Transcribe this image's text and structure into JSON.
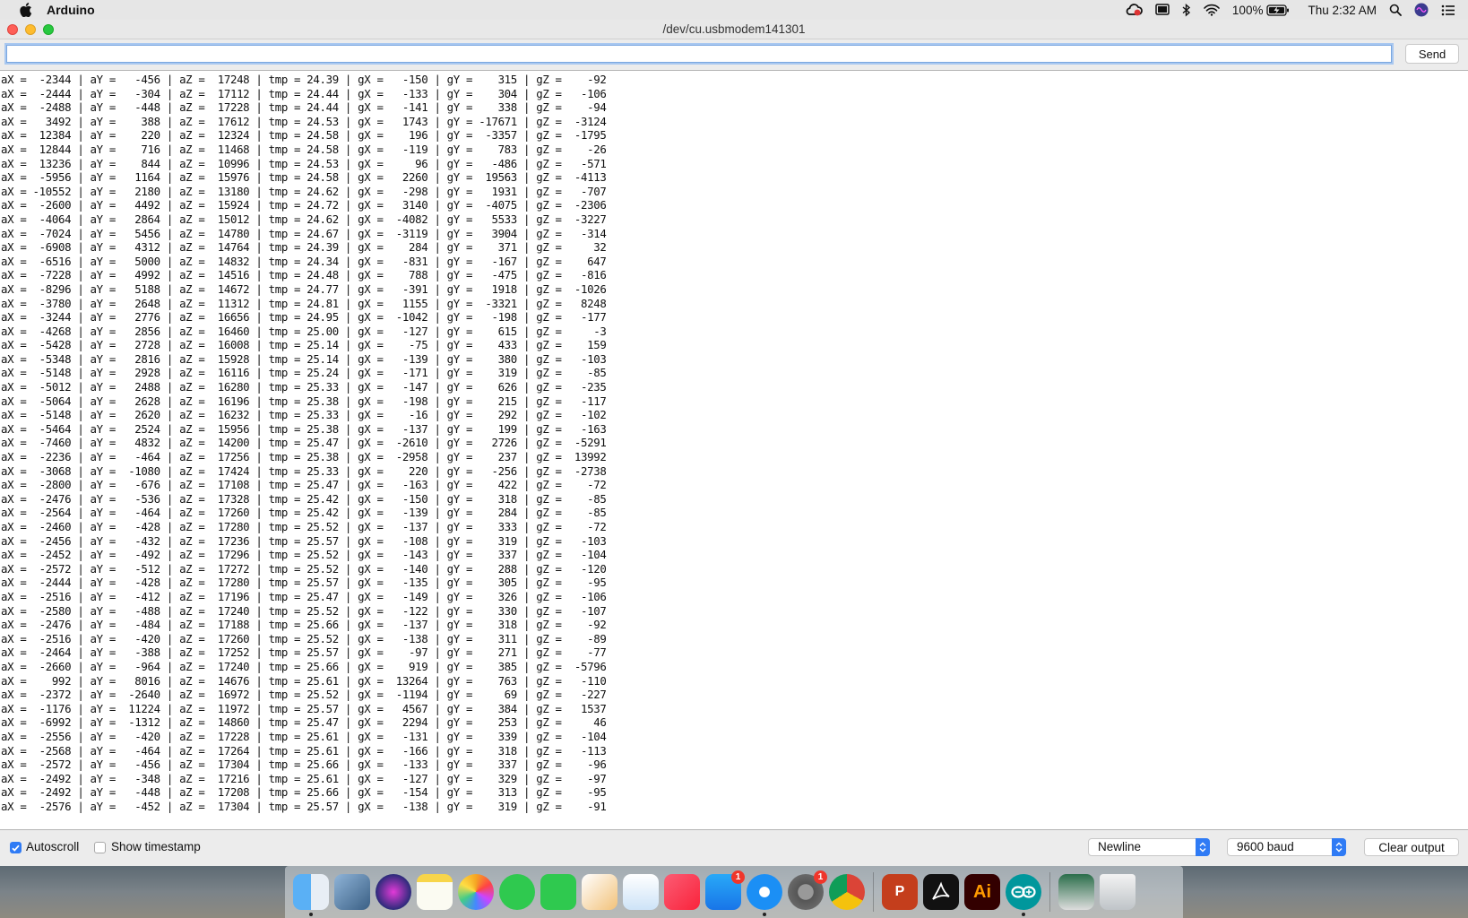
{
  "menubar": {
    "app_name": "Arduino",
    "battery": "100%",
    "clock": "Thu 2:32 AM"
  },
  "window": {
    "title": "/dev/cu.usbmodem141301"
  },
  "send_input": {
    "value": "",
    "placeholder": ""
  },
  "send_label": "Send",
  "serial_lines": [
    "aX =  -2344 | aY =   -456 | aZ =  17248 | tmp = 24.39 | gX =   -150 | gY =    315 | gZ =    -92",
    "aX =  -2444 | aY =   -304 | aZ =  17112 | tmp = 24.44 | gX =   -133 | gY =    304 | gZ =   -106",
    "aX =  -2488 | aY =   -448 | aZ =  17228 | tmp = 24.44 | gX =   -141 | gY =    338 | gZ =    -94",
    "aX =   3492 | aY =    388 | aZ =  17612 | tmp = 24.53 | gX =   1743 | gY = -17671 | gZ =  -3124",
    "aX =  12384 | aY =    220 | aZ =  12324 | tmp = 24.58 | gX =    196 | gY =  -3357 | gZ =  -1795",
    "aX =  12844 | aY =    716 | aZ =  11468 | tmp = 24.58 | gX =   -119 | gY =    783 | gZ =    -26",
    "aX =  13236 | aY =    844 | aZ =  10996 | tmp = 24.53 | gX =     96 | gY =   -486 | gZ =   -571",
    "aX =  -5956 | aY =   1164 | aZ =  15976 | tmp = 24.58 | gX =   2260 | gY =  19563 | gZ =  -4113",
    "aX = -10552 | aY =   2180 | aZ =  13180 | tmp = 24.62 | gX =   -298 | gY =   1931 | gZ =   -707",
    "aX =  -2600 | aY =   4492 | aZ =  15924 | tmp = 24.72 | gX =   3140 | gY =  -4075 | gZ =  -2306",
    "aX =  -4064 | aY =   2864 | aZ =  15012 | tmp = 24.62 | gX =  -4082 | gY =   5533 | gZ =  -3227",
    "aX =  -7024 | aY =   5456 | aZ =  14780 | tmp = 24.67 | gX =  -3119 | gY =   3904 | gZ =   -314",
    "aX =  -6908 | aY =   4312 | aZ =  14764 | tmp = 24.39 | gX =    284 | gY =    371 | gZ =     32",
    "aX =  -6516 | aY =   5000 | aZ =  14832 | tmp = 24.34 | gX =   -831 | gY =   -167 | gZ =    647",
    "aX =  -7228 | aY =   4992 | aZ =  14516 | tmp = 24.48 | gX =    788 | gY =   -475 | gZ =   -816",
    "aX =  -8296 | aY =   5188 | aZ =  14672 | tmp = 24.77 | gX =   -391 | gY =   1918 | gZ =  -1026",
    "aX =  -3780 | aY =   2648 | aZ =  11312 | tmp = 24.81 | gX =   1155 | gY =  -3321 | gZ =   8248",
    "aX =  -3244 | aY =   2776 | aZ =  16656 | tmp = 24.95 | gX =  -1042 | gY =   -198 | gZ =   -177",
    "aX =  -4268 | aY =   2856 | aZ =  16460 | tmp = 25.00 | gX =   -127 | gY =    615 | gZ =     -3",
    "aX =  -5428 | aY =   2728 | aZ =  16008 | tmp = 25.14 | gX =    -75 | gY =    433 | gZ =    159",
    "aX =  -5348 | aY =   2816 | aZ =  15928 | tmp = 25.14 | gX =   -139 | gY =    380 | gZ =   -103",
    "aX =  -5148 | aY =   2928 | aZ =  16116 | tmp = 25.24 | gX =   -171 | gY =    319 | gZ =    -85",
    "aX =  -5012 | aY =   2488 | aZ =  16280 | tmp = 25.33 | gX =   -147 | gY =    626 | gZ =   -235",
    "aX =  -5064 | aY =   2628 | aZ =  16196 | tmp = 25.38 | gX =   -198 | gY =    215 | gZ =   -117",
    "aX =  -5148 | aY =   2620 | aZ =  16232 | tmp = 25.33 | gX =    -16 | gY =    292 | gZ =   -102",
    "aX =  -5464 | aY =   2524 | aZ =  15956 | tmp = 25.38 | gX =   -137 | gY =    199 | gZ =   -163",
    "aX =  -7460 | aY =   4832 | aZ =  14200 | tmp = 25.47 | gX =  -2610 | gY =   2726 | gZ =  -5291",
    "aX =  -2236 | aY =   -464 | aZ =  17256 | tmp = 25.38 | gX =  -2958 | gY =    237 | gZ =  13992",
    "aX =  -3068 | aY =  -1080 | aZ =  17424 | tmp = 25.33 | gX =    220 | gY =   -256 | gZ =  -2738",
    "aX =  -2800 | aY =   -676 | aZ =  17108 | tmp = 25.47 | gX =   -163 | gY =    422 | gZ =    -72",
    "aX =  -2476 | aY =   -536 | aZ =  17328 | tmp = 25.42 | gX =   -150 | gY =    318 | gZ =    -85",
    "aX =  -2564 | aY =   -464 | aZ =  17260 | tmp = 25.42 | gX =   -139 | gY =    284 | gZ =    -85",
    "aX =  -2460 | aY =   -428 | aZ =  17280 | tmp = 25.52 | gX =   -137 | gY =    333 | gZ =    -72",
    "aX =  -2456 | aY =   -432 | aZ =  17236 | tmp = 25.57 | gX =   -108 | gY =    319 | gZ =   -103",
    "aX =  -2452 | aY =   -492 | aZ =  17296 | tmp = 25.52 | gX =   -143 | gY =    337 | gZ =   -104",
    "aX =  -2572 | aY =   -512 | aZ =  17272 | tmp = 25.52 | gX =   -140 | gY =    288 | gZ =   -120",
    "aX =  -2444 | aY =   -428 | aZ =  17280 | tmp = 25.57 | gX =   -135 | gY =    305 | gZ =    -95",
    "aX =  -2516 | aY =   -412 | aZ =  17196 | tmp = 25.47 | gX =   -149 | gY =    326 | gZ =   -106",
    "aX =  -2580 | aY =   -488 | aZ =  17240 | tmp = 25.52 | gX =   -122 | gY =    330 | gZ =   -107",
    "aX =  -2476 | aY =   -484 | aZ =  17188 | tmp = 25.66 | gX =   -137 | gY =    318 | gZ =    -92",
    "aX =  -2516 | aY =   -420 | aZ =  17260 | tmp = 25.52 | gX =   -138 | gY =    311 | gZ =    -89",
    "aX =  -2464 | aY =   -388 | aZ =  17252 | tmp = 25.57 | gX =    -97 | gY =    271 | gZ =    -77",
    "aX =  -2660 | aY =   -964 | aZ =  17240 | tmp = 25.66 | gX =    919 | gY =    385 | gZ =  -5796",
    "aX =    992 | aY =   8016 | aZ =  14676 | tmp = 25.61 | gX =  13264 | gY =    763 | gZ =   -110",
    "aX =  -2372 | aY =  -2640 | aZ =  16972 | tmp = 25.52 | gX =  -1194 | gY =     69 | gZ =   -227",
    "aX =  -1176 | aY =  11224 | aZ =  11972 | tmp = 25.57 | gX =   4567 | gY =    384 | gZ =   1537",
    "aX =  -6992 | aY =  -1312 | aZ =  14860 | tmp = 25.47 | gX =   2294 | gY =    253 | gZ =     46",
    "aX =  -2556 | aY =   -420 | aZ =  17228 | tmp = 25.61 | gX =   -131 | gY =    339 | gZ =   -104",
    "aX =  -2568 | aY =   -464 | aZ =  17264 | tmp = 25.61 | gX =   -166 | gY =    318 | gZ =   -113",
    "aX =  -2572 | aY =   -456 | aZ =  17304 | tmp = 25.66 | gX =   -133 | gY =    337 | gZ =    -96",
    "aX =  -2492 | aY =   -348 | aZ =  17216 | tmp = 25.61 | gX =   -127 | gY =    329 | gZ =    -97",
    "aX =  -2492 | aY =   -448 | aZ =  17208 | tmp = 25.66 | gX =   -154 | gY =    313 | gZ =    -95",
    "aX =  -2576 | aY =   -452 | aZ =  17304 | tmp = 25.57 | gX =   -138 | gY =    319 | gZ =    -91"
  ],
  "bottombar": {
    "autoscroll_label": "Autoscroll",
    "autoscroll_checked": true,
    "timestamp_label": "Show timestamp",
    "timestamp_checked": false,
    "line_ending": "Newline",
    "baud_rate": "9600 baud",
    "clear_label": "Clear output"
  },
  "dock": {
    "items": [
      {
        "icon": "finder-icon",
        "running": true
      },
      {
        "icon": "preview-icon"
      },
      {
        "icon": "siri-icon"
      },
      {
        "icon": "notes-icon"
      },
      {
        "icon": "photos-icon"
      },
      {
        "icon": "messages-icon"
      },
      {
        "icon": "facetime-icon"
      },
      {
        "icon": "pages-icon"
      },
      {
        "icon": "keynote-icon"
      },
      {
        "icon": "music-icon"
      },
      {
        "icon": "app-store-icon",
        "badge": "1"
      },
      {
        "icon": "safari-icon",
        "running": true
      },
      {
        "icon": "system-preferences-icon",
        "badge": "1"
      },
      {
        "icon": "chrome-icon"
      },
      {
        "icon": "powerpoint-icon",
        "label": "P"
      },
      {
        "icon": "acrobat-icon"
      },
      {
        "icon": "illustrator-icon",
        "label": "Ai"
      },
      {
        "icon": "arduino-icon",
        "running": true
      },
      {
        "icon": "downloads-stack-icon"
      },
      {
        "icon": "trash-icon"
      }
    ]
  },
  "colors": {
    "accent": "#2f7bf5",
    "close": "#fe5f57",
    "minimize": "#febc2e",
    "maximize": "#28c840"
  }
}
